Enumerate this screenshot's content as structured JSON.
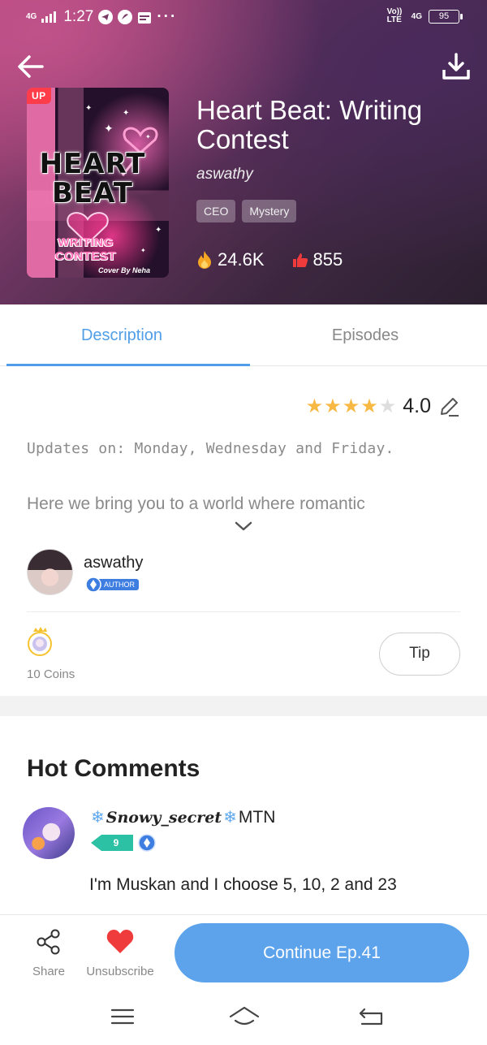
{
  "status_bar": {
    "network_left": "4G",
    "time": "1:27",
    "more": "···",
    "volte": "Vo)) LTE",
    "network_right": "4G",
    "battery": "95"
  },
  "book": {
    "cover": {
      "badge": "UP",
      "title": "HEART BEAT",
      "subtitle": "WRITING CONTEST",
      "credit": "Cover By Neha"
    },
    "title": "Heart Beat: Writing Contest",
    "author": "aswathy",
    "tags": [
      "CEO",
      "Mystery"
    ],
    "views": "24.6K",
    "likes": "855"
  },
  "tabs": [
    {
      "label": "Description",
      "active": true
    },
    {
      "label": "Episodes",
      "active": false
    }
  ],
  "description": {
    "rating": "4.0",
    "rating_stars_filled": 4,
    "rating_stars_total": 5,
    "update_schedule": "Updates on: Monday, Wednesday and Friday.",
    "synopsis_preview": "Here we bring you to a world where romantic"
  },
  "author_section": {
    "name": "aswathy",
    "badge": "AUTHOR"
  },
  "tips": {
    "coins_label": "10 Coins",
    "tip_button": "Tip"
  },
  "comments": {
    "heading": "Hot Comments",
    "items": [
      {
        "user_script": "Snowy_secret",
        "user_suffix": "MTN",
        "level": "9",
        "text": "I'm Muskan and I choose 5, 10, 2 and 23"
      }
    ]
  },
  "bottom_bar": {
    "share": "Share",
    "unsubscribe": "Unsubscribe",
    "continue": "Continue Ep.41"
  },
  "colors": {
    "accent": "#4f9ee7",
    "continue_button": "#5da3ec",
    "star": "#f7b844",
    "like_red": "#ef3b3b",
    "fire_orange": "#f5a623"
  }
}
